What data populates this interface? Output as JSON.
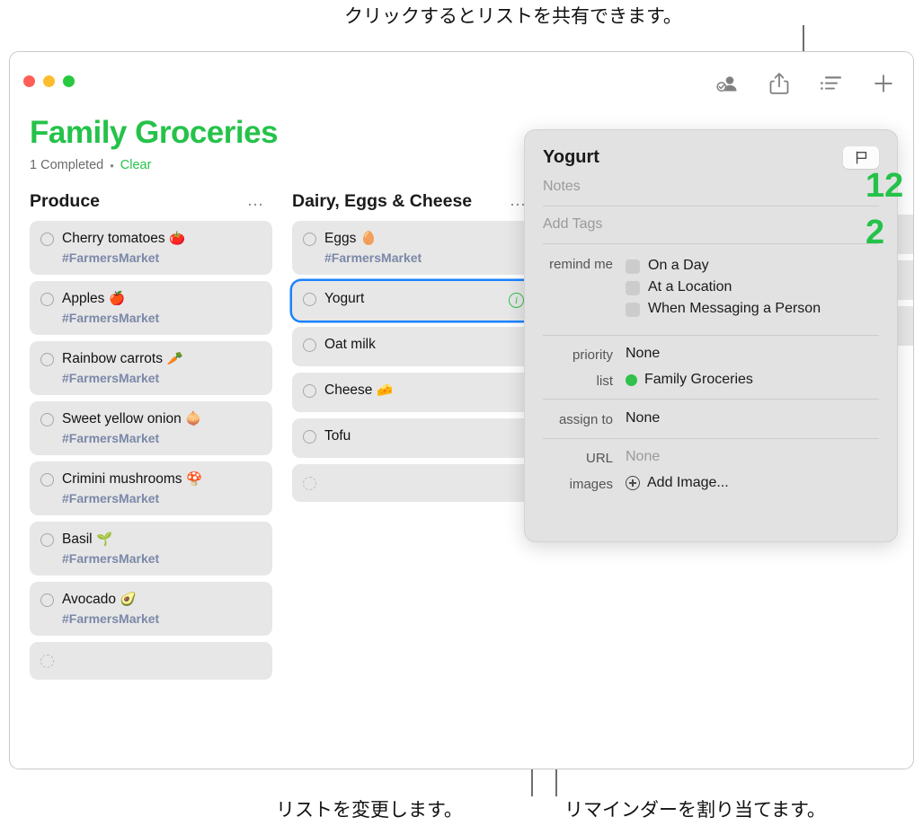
{
  "callouts": {
    "top": "クリックするとリストを共有できます。",
    "bottom_left": "リストを変更します。",
    "bottom_right": "リマインダーを割り当てます。"
  },
  "window": {
    "traffic_lights": [
      "close",
      "minimize",
      "zoom"
    ],
    "toolbar": [
      {
        "name": "assigned-to-me-icon",
        "label": "Assigned to Me"
      },
      {
        "name": "share-icon",
        "label": "Share"
      },
      {
        "name": "list-options-icon",
        "label": "View Options"
      },
      {
        "name": "add-reminder-icon",
        "label": "Add Reminder"
      }
    ]
  },
  "list": {
    "title": "Family Groceries",
    "title_color": "#25c24a",
    "completed_text": "1 Completed",
    "separator": "•",
    "clear_label": "Clear",
    "peek_numbers": [
      "12",
      "2"
    ]
  },
  "columns": [
    {
      "title": "Produce",
      "more_label": "…",
      "items": [
        {
          "title": "Cherry tomatoes",
          "emoji": "🍅",
          "tag": "#FarmersMarket"
        },
        {
          "title": "Apples",
          "emoji": "🍎",
          "tag": "#FarmersMarket"
        },
        {
          "title": "Rainbow carrots",
          "emoji": "🥕",
          "tag": "#FarmersMarket"
        },
        {
          "title": "Sweet yellow onion",
          "emoji": "🧅",
          "tag": "#FarmersMarket"
        },
        {
          "title": "Crimini mushrooms",
          "emoji": "🍄",
          "tag": "#FarmersMarket"
        },
        {
          "title": "Basil",
          "emoji": "🌱",
          "tag": "#FarmersMarket"
        },
        {
          "title": "Avocado",
          "emoji": "🥑",
          "tag": "#FarmersMarket"
        },
        {
          "title": "",
          "emoji": "",
          "tag": "",
          "empty": true
        }
      ]
    },
    {
      "title": "Dairy, Eggs & Cheese",
      "more_label": "…",
      "items": [
        {
          "title": "Eggs",
          "emoji": "🥚",
          "tag": "#FarmersMarket"
        },
        {
          "title": "Yogurt",
          "emoji": "",
          "tag": "",
          "selected": true,
          "info_badge": "i"
        },
        {
          "title": "Oat milk",
          "emoji": "",
          "tag": ""
        },
        {
          "title": "Cheese",
          "emoji": "🧀",
          "tag": ""
        },
        {
          "title": "Tofu",
          "emoji": "",
          "tag": ""
        },
        {
          "title": "",
          "emoji": "",
          "tag": "",
          "empty": true
        }
      ]
    }
  ],
  "popover": {
    "title": "Yogurt",
    "flag_icon": "flag-icon",
    "notes_placeholder": "Notes",
    "tags_placeholder": "Add Tags",
    "remind_me_label": "remind me",
    "remind_options": [
      "On a Day",
      "At a Location",
      "When Messaging a Person"
    ],
    "priority_label": "priority",
    "priority_value": "None",
    "list_label": "list",
    "list_value": "Family Groceries",
    "list_color": "#2fc14c",
    "assign_to_label": "assign to",
    "assign_to_value": "None",
    "url_label": "URL",
    "url_value": "None",
    "images_label": "images",
    "images_value": "Add Image..."
  }
}
